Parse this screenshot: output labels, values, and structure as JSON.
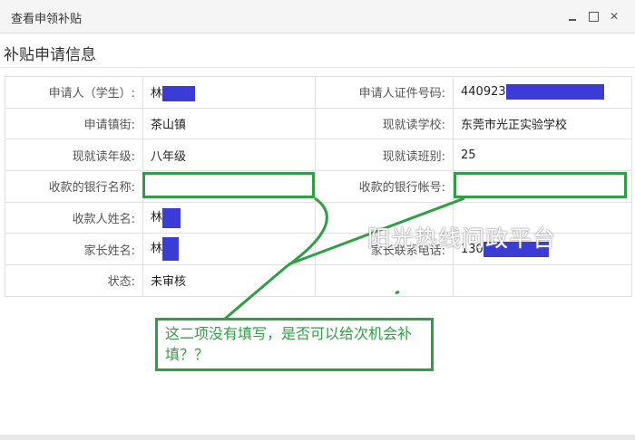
{
  "window": {
    "title": "查看申领补贴"
  },
  "section": {
    "title": "补贴申请信息"
  },
  "rows": [
    {
      "label": "申请人（学生）:",
      "value": "林",
      "label2": "申请人证件号码:",
      "value2": "440923"
    },
    {
      "label": "申请镇街:",
      "value": "茶山镇",
      "label2": "现就读学校:",
      "value2": "东莞市光正实验学校"
    },
    {
      "label": "现就读年级:",
      "value": "八年级",
      "label2": "现就读班别:",
      "value2": "25"
    },
    {
      "label": "收款的银行名称:",
      "value": "",
      "label2": "收款的银行帐号:",
      "value2": ""
    },
    {
      "label": "收款人姓名:",
      "value": "林",
      "label2": "",
      "value2": ""
    },
    {
      "label": "家长姓名:",
      "value": "林",
      "label2": "家长联系电话:",
      "value2": "130"
    },
    {
      "label": "状态:",
      "value": "未审核",
      "label2": "",
      "value2": ""
    }
  ],
  "annotation": {
    "text": "这二项没有填写，是否可以给次机会补填？？"
  },
  "watermark": {
    "text": "阳光热线问政平台"
  },
  "colors": {
    "highlight": "#2f9e44",
    "redaction": "#3b3bd6"
  }
}
